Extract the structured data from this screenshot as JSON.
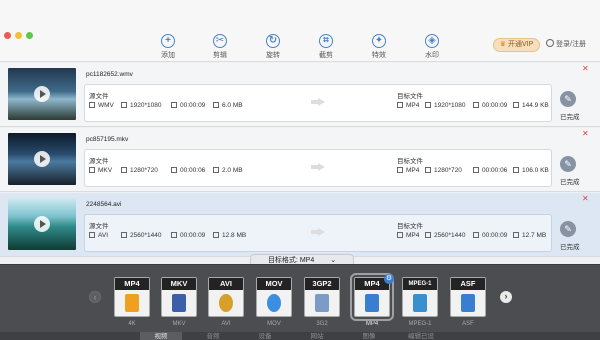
{
  "toolbar": {
    "tools": [
      {
        "label": "添加",
        "icon": "plus-icon",
        "glyph": "+"
      },
      {
        "label": "剪辑",
        "icon": "scissors-icon",
        "glyph": "✂"
      },
      {
        "label": "旋转",
        "icon": "rotate-icon",
        "glyph": "↻"
      },
      {
        "label": "截剪",
        "icon": "crop-icon",
        "glyph": "⌗"
      },
      {
        "label": "特效",
        "icon": "effects-icon",
        "glyph": "✦"
      },
      {
        "label": "水印",
        "icon": "watermark-icon",
        "glyph": "◈"
      }
    ],
    "vip_label": "开通VIP",
    "login_label": "登录/注册"
  },
  "files": [
    {
      "name": "pc1182652.wmv",
      "source_title": "源文件",
      "target_title": "目标文件",
      "source": {
        "format": "WMV",
        "resolution": "1920*1080",
        "duration": "00:00:09",
        "size": "6.0 MB"
      },
      "target": {
        "format": "MP4",
        "resolution": "1920*1080",
        "duration": "00:00:09",
        "size": "144.9 KB"
      },
      "status": "已完成"
    },
    {
      "name": "pc857195.mkv",
      "source_title": "源文件",
      "target_title": "目标文件",
      "source": {
        "format": "MKV",
        "resolution": "1280*720",
        "duration": "00:00:06",
        "size": "2.0 MB"
      },
      "target": {
        "format": "MP4",
        "resolution": "1280*720",
        "duration": "00:00:06",
        "size": "106.0 KB"
      },
      "status": "已完成"
    },
    {
      "name": "2248564.avi",
      "source_title": "源文件",
      "target_title": "目标文件",
      "source": {
        "format": "AVI",
        "resolution": "2560*1440",
        "duration": "00:00:09",
        "size": "12.8 MB"
      },
      "target": {
        "format": "MP4",
        "resolution": "2560*1440",
        "duration": "00:00:09",
        "size": "12.7 MB"
      },
      "status": "已完成"
    }
  ],
  "target_format_label": "目标格式: MP4",
  "formats": [
    {
      "tag": "MP4",
      "caption": "4K",
      "color": "#f0a020"
    },
    {
      "tag": "MKV",
      "caption": "MKV",
      "color": "#3b5fa8"
    },
    {
      "tag": "AVI",
      "caption": "AVI",
      "color": "#d8a028"
    },
    {
      "tag": "MOV",
      "caption": "MOV",
      "color": "#3c8fe0"
    },
    {
      "tag": "3GP2",
      "caption": "3G2",
      "color": "#7c9cc8"
    },
    {
      "tag": "MP4",
      "caption": "MP4",
      "color": "#3a7fcf"
    },
    {
      "tag": "MPEG-1",
      "caption": "MPEG-1",
      "color": "#3a8fcf"
    },
    {
      "tag": "ASF",
      "caption": "ASF",
      "color": "#3a7fcf"
    }
  ],
  "categories": [
    "视频",
    "音频",
    "设备",
    "网站",
    "图像",
    "编辑已设"
  ]
}
